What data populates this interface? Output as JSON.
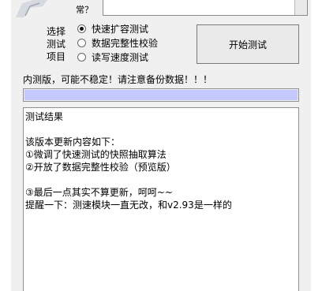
{
  "app": {
    "top_label": "常？",
    "top_combo_value": ""
  },
  "options": {
    "group_label_lines": [
      "选择",
      "测试",
      "项目"
    ],
    "items": [
      {
        "label": "快速扩容测试",
        "selected": true
      },
      {
        "label": "数据完整性校验",
        "selected": false
      },
      {
        "label": "读写速度测试",
        "selected": false
      }
    ]
  },
  "start_button_label": "开始测试",
  "warning_text": "内测版，可能不稳定！请注意备份数据！！！",
  "progress": {
    "fraction": 1.0,
    "fill_color": "#c5c8ff"
  },
  "log": {
    "lines": [
      "测试结果",
      "",
      "该版本更新内容如下：",
      "①微调了快速测试的快照抽取算法",
      "②开放了数据完整性校验（预览版）",
      "",
      "③最后一点其实不算更新，呵呵~~",
      "提醒一下：测速模块一直无改，和v2.93是一样的"
    ]
  }
}
